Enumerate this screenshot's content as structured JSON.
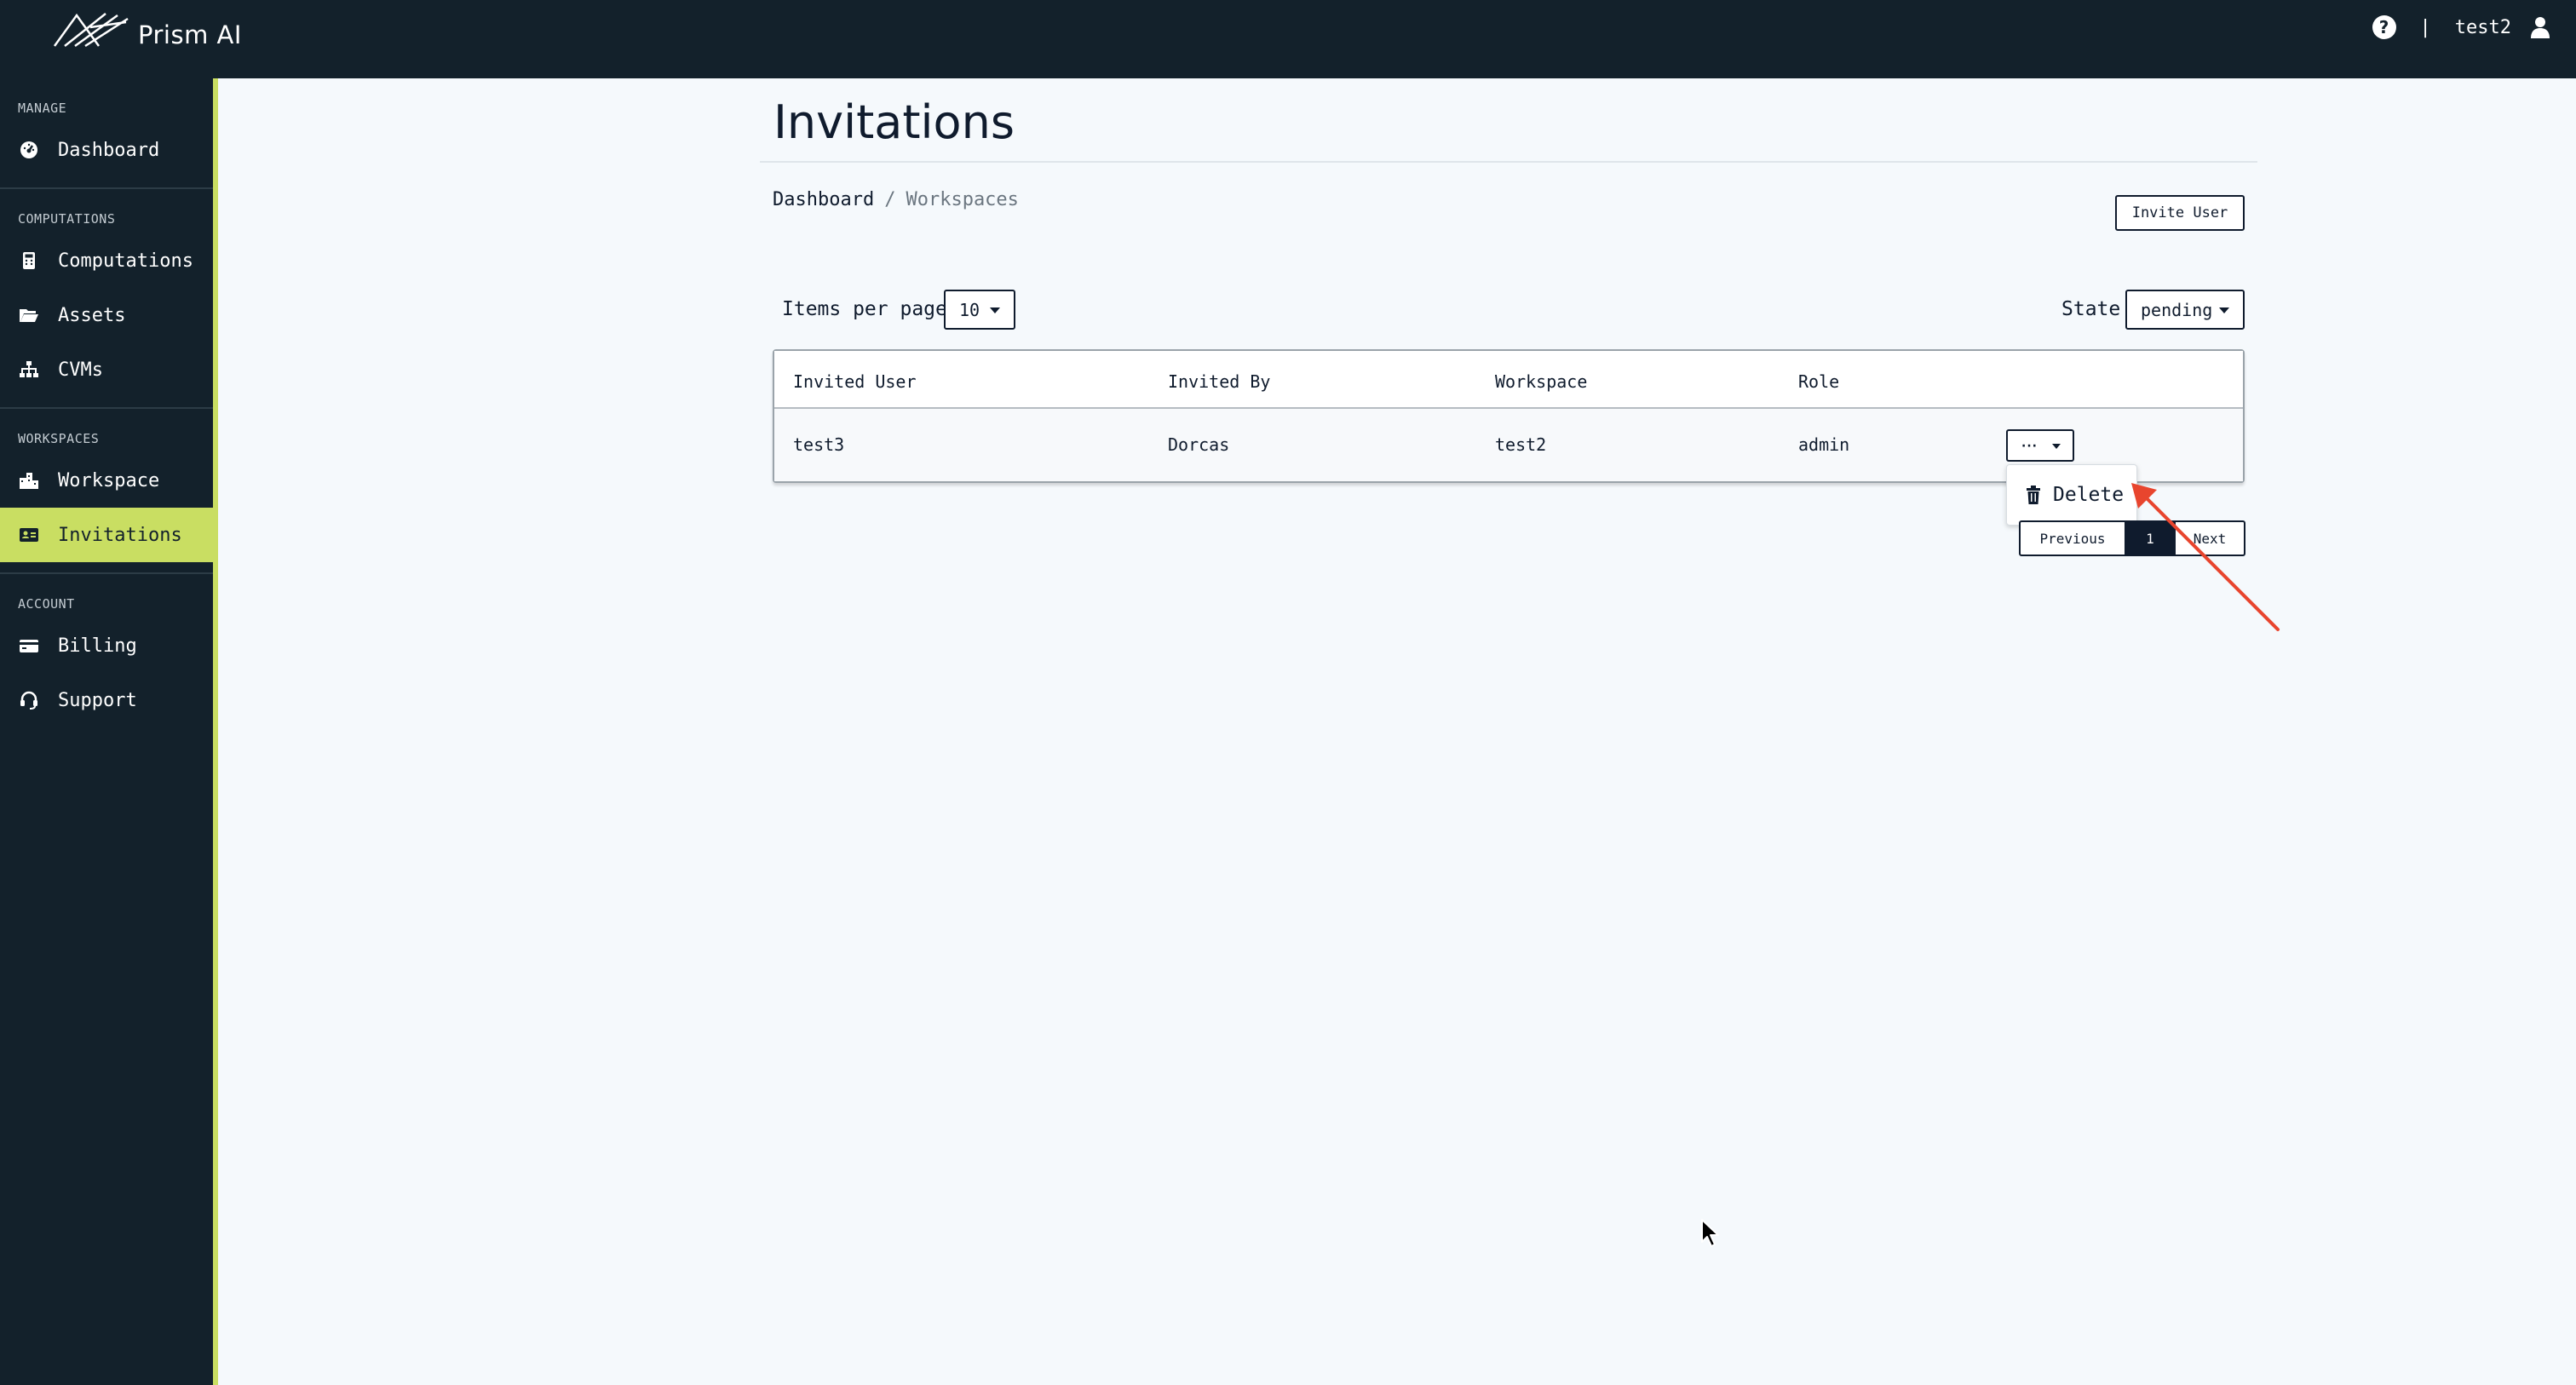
{
  "app": {
    "name": "Prism AI"
  },
  "topbar": {
    "help_icon": "help-icon",
    "separator": "|",
    "username": "test2",
    "user_icon": "user-icon"
  },
  "sidebar": {
    "sections": [
      {
        "title": "MANAGE",
        "items": [
          {
            "label": "Dashboard",
            "icon": "dashboard-gauge-icon"
          }
        ]
      },
      {
        "title": "COMPUTATIONS",
        "items": [
          {
            "label": "Computations",
            "icon": "calculator-icon"
          },
          {
            "label": "Assets",
            "icon": "folder-open-icon"
          },
          {
            "label": "CVMs",
            "icon": "sitemap-icon"
          }
        ]
      },
      {
        "title": "WORKSPACES",
        "items": [
          {
            "label": "Workspace",
            "icon": "city-icon"
          },
          {
            "label": "Invitations",
            "icon": "id-card-icon",
            "active": true
          }
        ]
      },
      {
        "title": "ACCOUNT",
        "items": [
          {
            "label": "Billing",
            "icon": "credit-card-icon"
          },
          {
            "label": "Support",
            "icon": "headset-icon"
          }
        ]
      }
    ]
  },
  "page": {
    "title": "Invitations",
    "breadcrumb": {
      "parent": "Dashboard",
      "separator": "/",
      "current": "Workspaces"
    },
    "invite_button": "Invite User"
  },
  "filters": {
    "items_per_page_label": "Items per page",
    "items_per_page_value": "10",
    "state_label": "State",
    "state_value": "pending"
  },
  "table": {
    "columns": [
      "Invited User",
      "Invited By",
      "Workspace",
      "Role"
    ],
    "rows": [
      {
        "invited_user": "test3",
        "invited_by": "Dorcas",
        "workspace": "test2",
        "role": "admin",
        "actions_label": "···"
      }
    ]
  },
  "actions_menu": {
    "items": [
      {
        "label": "Delete",
        "icon": "trash-icon"
      }
    ]
  },
  "pagination": {
    "previous": "Previous",
    "current_page": "1",
    "next": "Next"
  },
  "colors": {
    "sidebar_bg": "#13212b",
    "accent": "#c9de62",
    "page_bg": "#f5f9fc",
    "annotation_arrow": "#e8452e"
  }
}
